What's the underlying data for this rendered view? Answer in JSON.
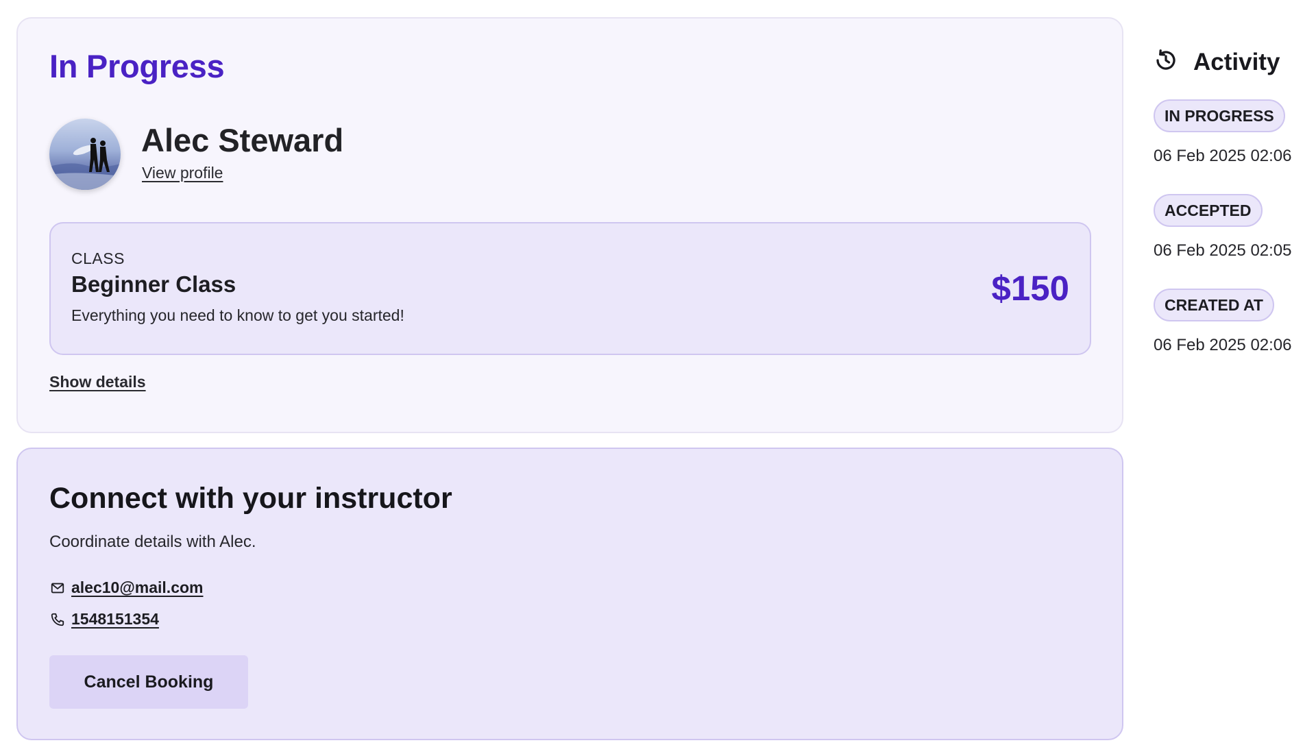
{
  "booking": {
    "status_title": "In Progress",
    "instructor": {
      "name": "Alec Steward",
      "profile_link_label": "View profile"
    },
    "class": {
      "kicker": "CLASS",
      "name": "Beginner Class",
      "description": "Everything you need to know to get you started!",
      "price": "$150"
    },
    "show_details_label": "Show details"
  },
  "connect": {
    "title": "Connect with your instructor",
    "subtitle": "Coordinate details with Alec.",
    "email": "alec10@mail.com",
    "phone": "1548151354",
    "cancel_label": "Cancel Booking"
  },
  "activity": {
    "title": "Activity",
    "icon": "history-icon",
    "items": [
      {
        "label": "IN PROGRESS",
        "time": "06 Feb 2025 02:06"
      },
      {
        "label": "ACCEPTED",
        "time": "06 Feb 2025 02:05"
      },
      {
        "label": "CREATED AT",
        "time": "06 Feb 2025 02:06"
      }
    ]
  },
  "colors": {
    "accent": "#4a22c4",
    "card_bg": "#f7f5fd",
    "tint_bg": "#ebe7fa",
    "tint_border": "#cfc6f0",
    "button_bg": "#dcd4f6"
  }
}
